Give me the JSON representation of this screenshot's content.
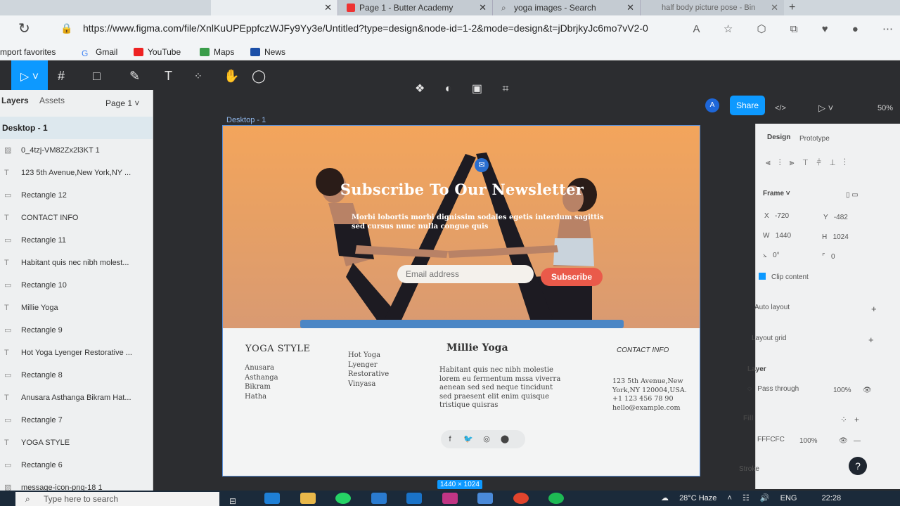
{
  "browser": {
    "tabs": [
      {
        "label": "Page 1 - Butter Academy",
        "color": "#e33"
      },
      {
        "label": "yoga images - Search",
        "color": "#888"
      },
      {
        "label": "half body picture pose - Bin",
        "color": "#aaa"
      }
    ],
    "url": "https://www.figma.com/file/XnlKuUPEppfczWJFy9Yy3e/Untitled?type=design&node-id=1-2&mode=design&t=jDbrjkyJc6mo7vV2-0",
    "bookmarks": [
      "mport favorites",
      "Gmail",
      "YouTube",
      "Maps",
      "News"
    ]
  },
  "figma": {
    "share_label": "Share",
    "avatar_initial": "A",
    "zoom": "50%",
    "layers_panel": {
      "tab_layers": "Layers",
      "tab_assets": "Assets",
      "page": "Page 1",
      "frame_name": "Desktop - 1",
      "items": [
        "0_4tzj-VM82Zx2l3KT 1",
        "123 5th Avenue,New York,NY ...",
        "Rectangle 12",
        "CONTACT INFO",
        "Rectangle 11",
        "Habitant quis nec nibh molest...",
        "Rectangle 10",
        "Millie Yoga",
        "Rectangle 9",
        "Hot Yoga Lyenger Restorative ...",
        "Rectangle 8",
        "Anusara Asthanga Bikram Hat...",
        "Rectangle 7",
        "YOGA STYLE",
        "Rectangle 6",
        "message-icon-png-18 1"
      ]
    },
    "canvas": {
      "frame_label": "Desktop - 1",
      "size_badge": "1440 × 1024",
      "hero_title": "Subscribe To Our Newsletter",
      "hero_subtitle": "Morbi lobortis morbi dignissim sodales egetis interdum sagittis sed cursus nunc nulla congue quis",
      "email_placeholder": "Email address",
      "subscribe_label": "Subscribe",
      "yoga_style_heading": "YOGA STYLE",
      "yoga_styles": [
        "Anusara",
        "Asthanga",
        "Bikram",
        "Hatha"
      ],
      "yoga_types": [
        "Hot Yoga",
        "Lyenger",
        "Restorative",
        "Vinyasa"
      ],
      "brand_name": "Millie Yoga",
      "brand_text": "Habitant quis nec nibh molestie lorem eu fermentum mssa viverra aenean sed sed neque tincidunt sed praesent elit enim quisque tristique quisras",
      "contact_heading": "CONTACT INFO",
      "contact_address": "123 5th Avenue,New York,NY 120004,USA.",
      "contact_phone": "+1 123 456 78 90",
      "contact_email": "hello@example.com"
    },
    "design_panel": {
      "tab_design": "Design",
      "tab_prototype": "Prototype",
      "frame_label": "Frame",
      "x": "-720",
      "y": "-482",
      "w": "1440",
      "h": "1024",
      "rotation": "0°",
      "radius": "0",
      "clip_content": "Clip content",
      "auto_layout": "Auto layout",
      "layout_grid": "Layout grid",
      "layer": "Layer",
      "pass_through": "Pass through",
      "layer_opacity": "100%",
      "fill": "Fill",
      "fill_hex": "FFFCFC",
      "fill_opacity": "100%",
      "stroke": "Stroke"
    }
  },
  "taskbar": {
    "search_placeholder": "Type here to search",
    "weather": "28°C Haze",
    "lang": "ENG",
    "time": "22:28"
  }
}
